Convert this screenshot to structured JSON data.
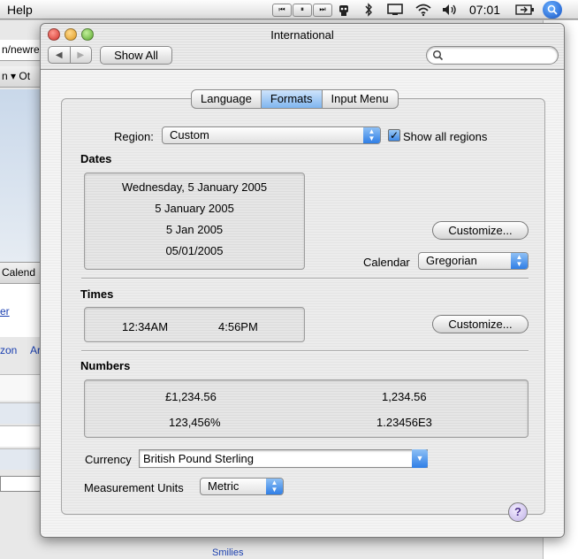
{
  "menubar": {
    "app_menu": "Help",
    "clock": "07:01",
    "media": {
      "prev": "⏮",
      "pause": "⏸",
      "next": "⏭"
    }
  },
  "background_app": {
    "url_fragment": "n/newre",
    "toolbar_fragment": "n ▾  Ot",
    "tab_fragment": "Calend",
    "link1": "er",
    "link2": "zon",
    "link3": "Ar",
    "bottom_fragment": "Smilies"
  },
  "window": {
    "title": "International",
    "show_all_label": "Show All",
    "search": {
      "value": "",
      "placeholder": ""
    },
    "tabs": [
      {
        "label": "Language",
        "active": false
      },
      {
        "label": "Formats",
        "active": true
      },
      {
        "label": "Input Menu",
        "active": false
      }
    ],
    "region": {
      "label": "Region:",
      "value": "Custom",
      "show_all_label": "Show all regions",
      "show_all_checked": true
    },
    "dates": {
      "title": "Dates",
      "samples": [
        "Wednesday, 5 January 2005",
        "5 January 2005",
        "5 Jan 2005",
        "05/01/2005"
      ],
      "customize_label": "Customize...",
      "calendar_label": "Calendar",
      "calendar_value": "Gregorian"
    },
    "times": {
      "title": "Times",
      "sample_am": "12:34AM",
      "sample_pm": "4:56PM",
      "customize_label": "Customize..."
    },
    "numbers": {
      "title": "Numbers",
      "currency_sample": "£1,234.56",
      "decimal_sample": "1,234.56",
      "percent_sample": "123,456%",
      "scientific_sample": "1.23456E3"
    },
    "currency": {
      "label": "Currency",
      "value": "British Pound Sterling"
    },
    "measurement": {
      "label": "Measurement Units",
      "value": "Metric"
    },
    "help_label": "?"
  },
  "colors": {
    "accent_blue": "#2f7ee6",
    "close": "#e0443e",
    "minimize": "#e9a93a",
    "zoom": "#7bc24a"
  }
}
